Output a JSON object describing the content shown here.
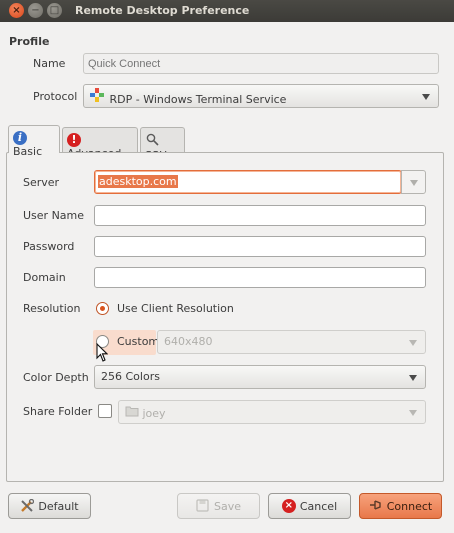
{
  "window": {
    "title": "Remote Desktop Preference",
    "close_glyph": "×",
    "min_glyph": "−",
    "max_glyph": "□"
  },
  "profile": {
    "heading": "Profile",
    "name_label": "Name",
    "name_placeholder": "Quick Connect",
    "protocol_label": "Protocol",
    "protocol_value": "RDP - Windows Terminal Service"
  },
  "tabs": [
    {
      "label": "Basic",
      "icon": "info-icon"
    },
    {
      "label": "Advanced",
      "icon": "warning-icon"
    },
    {
      "label": "SSH",
      "icon": "magnifier-icon"
    }
  ],
  "basic": {
    "server_label": "Server",
    "server_value": "adesktop.com",
    "username_label": "User Name",
    "username_value": "",
    "password_label": "Password",
    "password_value": "",
    "domain_label": "Domain",
    "domain_value": "",
    "resolution_label": "Resolution",
    "resolution_option_client": "Use Client Resolution",
    "resolution_option_custom": "Custom",
    "custom_resolution_value": "640x480",
    "color_depth_label": "Color Depth",
    "color_depth_value": "256 Colors",
    "share_folder_label": "Share Folder",
    "share_folder_value": "joey"
  },
  "buttons": {
    "default": "Default",
    "save": "Save",
    "cancel": "Cancel",
    "connect": "Connect"
  },
  "colors": {
    "accent": "#e8784a",
    "focus": "#e36d3b",
    "titlebar": "#3c3b37"
  }
}
